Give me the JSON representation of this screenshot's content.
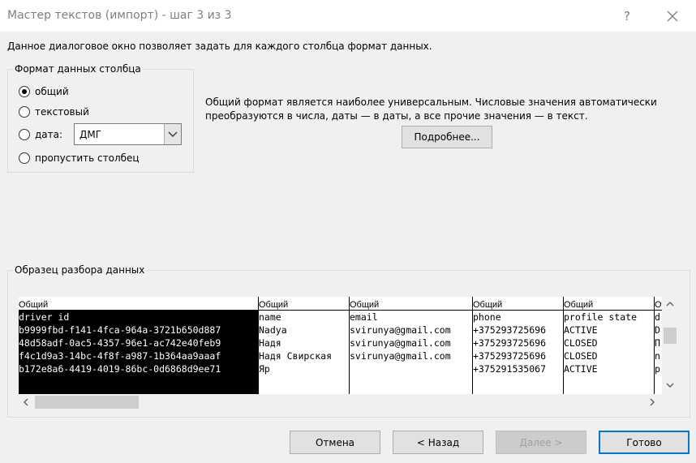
{
  "window": {
    "title": "Мастер текстов (импорт) - шаг 3 из 3",
    "help_label": "?"
  },
  "description": "Данное диалоговое окно позволяет задать для каждого столбца формат данных.",
  "format_group": {
    "caption": "Формат данных столбца",
    "options": [
      {
        "label": "общий",
        "checked": true
      },
      {
        "label": "текстовый",
        "checked": false
      },
      {
        "label": "дата:",
        "checked": false
      },
      {
        "label": "пропустить столбец",
        "checked": false
      }
    ],
    "date_format": "ДМГ"
  },
  "info": {
    "text": "Общий формат является наиболее универсальным. Числовые значения автоматически преобразуются в числа, даты — в даты, а все прочие значения — в текст.",
    "details_button": "Подробнее..."
  },
  "preview": {
    "caption": "Образец разбора данных",
    "columns": [
      {
        "header": "Общий",
        "cells": [
          "driver id",
          "b9999fbd-f141-4fca-964a-3721b650d887",
          "48d58adf-0ac5-4357-96e1-ac742e40feb9",
          "f4c1d9a3-14bc-4f8f-a987-1b364aa9aaaf",
          "b172e8a6-4419-4019-86bc-0d6868d9ee71"
        ]
      },
      {
        "header": "Общий",
        "cells": [
          "name",
          "Nadya",
          "Надя",
          "Надя Свирская",
          "Яр"
        ]
      },
      {
        "header": "Общий",
        "cells": [
          "email",
          "svirunya@gmail.com",
          "svirunya@gmail.com",
          "svirunya@gmail.com",
          ""
        ]
      },
      {
        "header": "Общий",
        "cells": [
          "phone",
          "+375293725696",
          "+375293725696",
          "+375293725696",
          "+375291535067"
        ]
      },
      {
        "header": "Общий",
        "cells": [
          "profile state",
          "ACTIVE",
          "CLOSED",
          "CLOSED",
          "ACTIVE"
        ]
      },
      {
        "header": "О",
        "cells": [
          "d",
          "D",
          "П",
          "n",
          "p"
        ]
      }
    ]
  },
  "buttons": {
    "cancel": "Отмена",
    "back": "< Назад",
    "next": "Далее >",
    "finish": "Готово"
  }
}
